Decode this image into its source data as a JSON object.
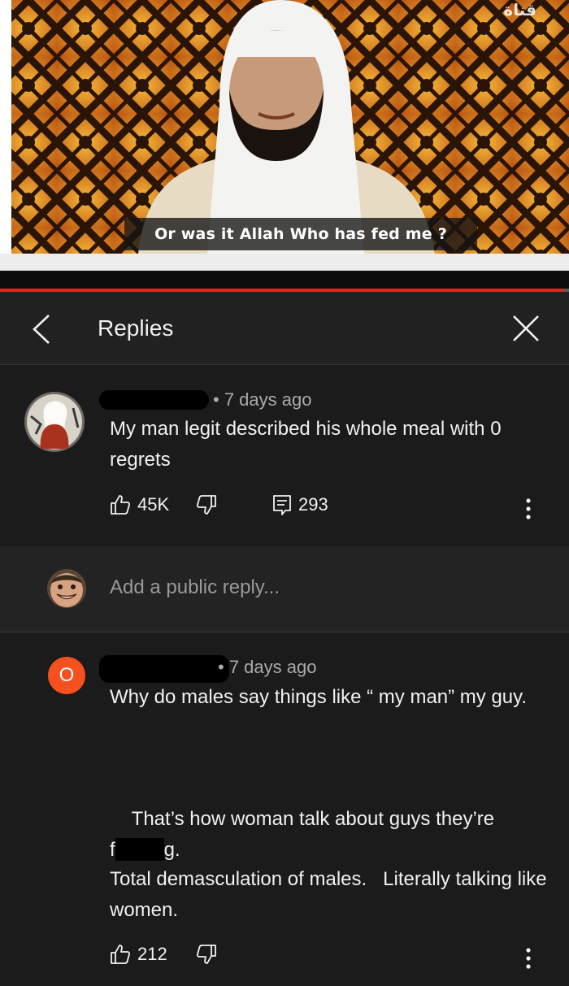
{
  "video": {
    "caption": "Or was it Allah Who has fed me ?",
    "channel_logo": "قناة",
    "progress_fraction": 0.99
  },
  "header": {
    "title": "Replies"
  },
  "parent_comment": {
    "timestamp": "• 7 days ago",
    "text": "My man legit described his whole meal with 0 regrets",
    "likes": "45K",
    "replies": "293"
  },
  "reply_input": {
    "placeholder": "Add a public reply..."
  },
  "reply_comment": {
    "avatar_letter": "O",
    "timestamp": "• 7 days ago",
    "para1": "Why do males say things like “ my man” my guy.",
    "para2_start": "That’s how woman talk about guys they’re",
    "para2_f": "f",
    "para2_end": "g.",
    "para3": "Total demasculation of males.   Literally talking like women.",
    "likes": "212"
  },
  "colors": {
    "background": "#181818",
    "progress": "#e8231f",
    "letter_avatar": "#f4511e"
  }
}
